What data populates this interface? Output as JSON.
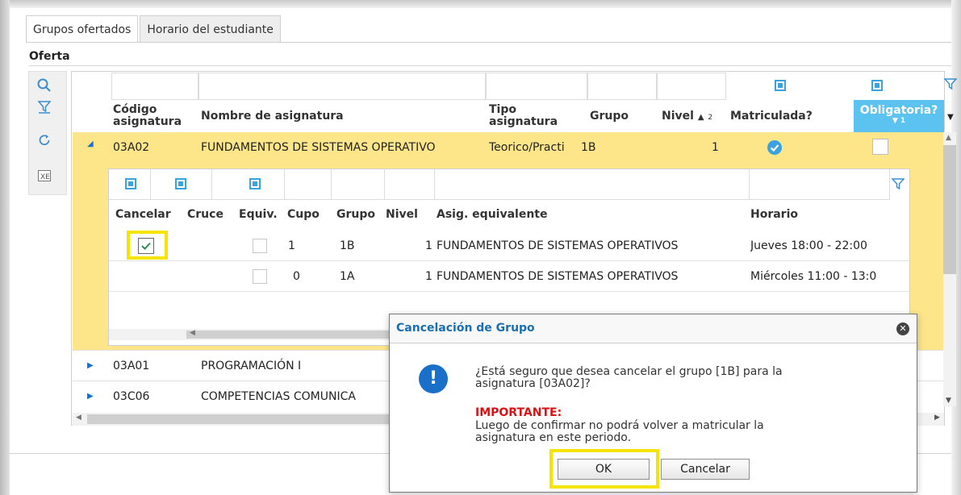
{
  "tabs": [
    {
      "label": "Grupos ofertados",
      "active": true
    },
    {
      "label": "Horario del estudiante",
      "active": false
    }
  ],
  "section_title": "Oferta",
  "toolbar": {
    "icons": [
      "search-icon",
      "filter-icon",
      "refresh-icon",
      "excel-export-icon"
    ]
  },
  "grid": {
    "headers": {
      "codigo_line1": "Código",
      "codigo_line2": "asignatura",
      "nombre": "Nombre de asignatura",
      "tipo_line1": "Tipo",
      "tipo_line2": "asignatura",
      "grupo": "Grupo",
      "nivel": "Nivel",
      "nivel_sort_index": "2",
      "matriculada": "Matriculada?",
      "obligatoria": "Obligatoria?",
      "obligatoria_sort_index": "1"
    },
    "rows": [
      {
        "codigo": "03A02",
        "nombre": "FUNDAMENTOS DE SISTEMAS OPERATIVO",
        "tipo": "Teorico/Practi",
        "grupo": "1B",
        "nivel": "1",
        "matriculada": true,
        "expanded": true
      },
      {
        "codigo": "03A01",
        "nombre": "PROGRAMACIÓN I"
      },
      {
        "codigo": "03C06",
        "nombre": "COMPETENCIAS COMUNICA"
      }
    ]
  },
  "subgrid": {
    "headers": {
      "cancelar": "Cancelar",
      "cruce": "Cruce",
      "equiv": "Equiv.",
      "cupo": "Cupo",
      "grupo": "Grupo",
      "nivel": "Nivel",
      "asig": "Asig. equivalente",
      "horario": "Horario"
    },
    "rows": [
      {
        "cupo": "1",
        "grupo": "1B",
        "nivel": "1",
        "asig": "FUNDAMENTOS DE SISTEMAS OPERATIVOS",
        "horario": "Jueves 18:00 - 22:00",
        "cancel_checked": true
      },
      {
        "cupo": "0",
        "grupo": "1A",
        "nivel": "1",
        "asig": "FUNDAMENTOS DE SISTEMAS OPERATIVOS",
        "horario": "Miércoles 11:00 - 13:0",
        "cancel_checked": false
      }
    ]
  },
  "dialog": {
    "title": "Cancelación de Grupo",
    "message_line1": "¿Está seguro que desea cancelar el grupo [1B] para la",
    "message_line2": "asignatura [03A02]?",
    "important_label": "IMPORTANTE:",
    "warning_line1": "Luego de confirmar no podrá volver a matricular la",
    "warning_line2": "asignatura en este periodo.",
    "ok_label": "OK",
    "cancel_label": "Cancelar"
  },
  "colors": {
    "selected_row": "#fde58a",
    "highlight": "#f4e400",
    "accent_blue": "#3aa3df",
    "dialog_title": "#1b6fb1",
    "important_red": "#d11111"
  }
}
